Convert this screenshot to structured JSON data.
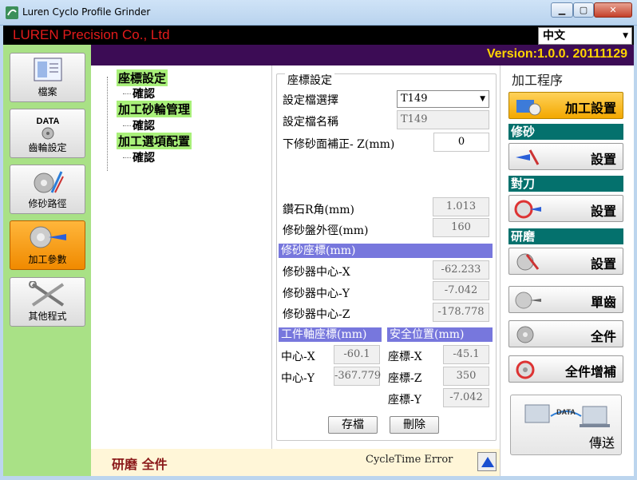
{
  "window": {
    "title": "Luren Cyclo Profile Grinder"
  },
  "header": {
    "company": "LUREN Precision Co., Ltd",
    "language": "中文",
    "version": "Version:1.0.0.   20111129"
  },
  "leftnav": {
    "items": [
      {
        "label": "檔案",
        "icon": "document-icon"
      },
      {
        "label": "齒輪設定",
        "icon": "data-icon"
      },
      {
        "label": "修砂路徑",
        "icon": "dressing-path-icon"
      },
      {
        "label": "加工參數",
        "icon": "grinding-wheel-icon",
        "active": true
      },
      {
        "label": "其他程式",
        "icon": "tools-icon"
      }
    ]
  },
  "tree": {
    "nodes": [
      {
        "label": "座標設定",
        "child": "確認"
      },
      {
        "label": "加工砂輪管理",
        "child": "確認"
      },
      {
        "label": "加工選項配置",
        "child": "確認"
      }
    ]
  },
  "form": {
    "title": "座標設定",
    "file_select_label": "設定檔選擇",
    "file_select_value": "T149",
    "file_name_label": "設定檔名稱",
    "file_name_value": "T149",
    "lower_correction_label": "下修砂面補正- Z(mm)",
    "lower_correction_value": "0",
    "diamond_r_label": "鑽石R角(mm)",
    "diamond_r_value": "1.013",
    "dresser_diameter_label": "修砂盤外徑(mm)",
    "dresser_diameter_value": "160",
    "dresser_coord_section": "修砂座標(mm)",
    "dresser_x_label": "修砂器中心-X",
    "dresser_x_value": "-62.233",
    "dresser_y_label": "修砂器中心-Y",
    "dresser_y_value": "-7.042",
    "dresser_z_label": "修砂器中心-Z",
    "dresser_z_value": "-178.778",
    "work_axis_section": "工件軸座標(mm)",
    "work_x_label": "中心-X",
    "work_x_value": "-60.1",
    "work_y_label": "中心-Y",
    "work_y_value": "-367.779",
    "safe_section": "安全位置(mm)",
    "safe_x_label": "座標-X",
    "safe_x_value": "-45.1",
    "safe_z_label": "座標-Z",
    "safe_z_value": "350",
    "safe_y_label": "座標-Y",
    "safe_y_value": "-7.042",
    "save_label": "存檔",
    "delete_label": "刪除"
  },
  "status": {
    "left": "研磨 全件",
    "middle": "CycleTime Error"
  },
  "rightpanel": {
    "title": "加工程序",
    "machining_setup": "加工設置",
    "dressing_head": "修砂",
    "dressing_setup": "設置",
    "tool_head": "對刀",
    "tool_setup": "設置",
    "grinding_head": "研磨",
    "grinding_setup": "設置",
    "single_tooth": "單齒",
    "full_part": "全件",
    "full_compensation": "全件增補",
    "transfer": "傳送",
    "transfer_icon_text": "DATA"
  },
  "colors": {
    "nav_bg": "#a9e186",
    "active": "#f39a12",
    "version_bar": "#3c0c55",
    "version_text": "#ffd400",
    "section": "#7777dd",
    "right_head": "#04716d",
    "company": "#e31b1b"
  }
}
